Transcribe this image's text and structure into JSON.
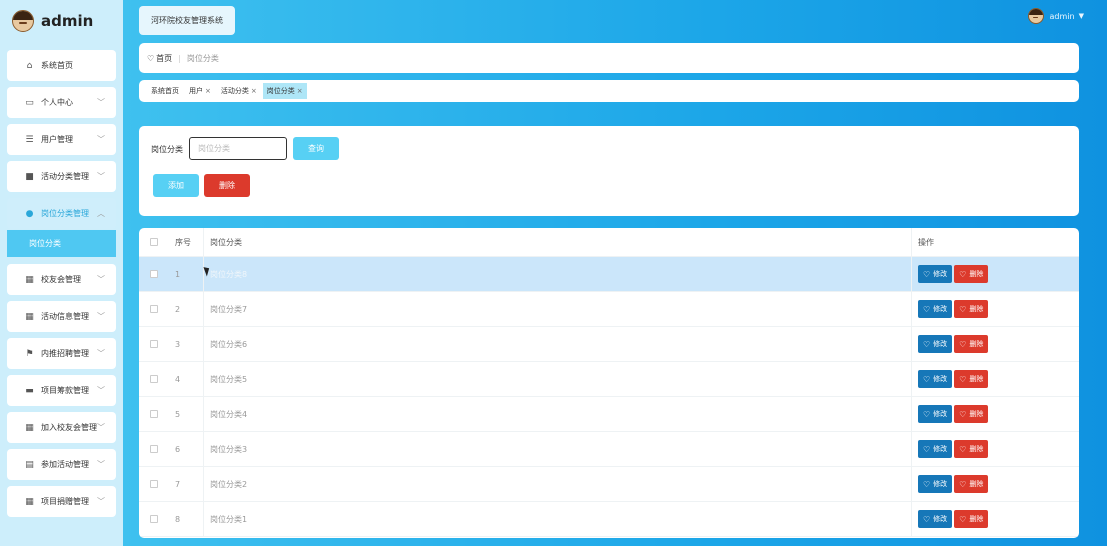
{
  "brand": {
    "name": "admin"
  },
  "sidebar": {
    "items": [
      {
        "label": "系统首页",
        "icon": "home-icon",
        "glyph": "⌂",
        "chevron": false
      },
      {
        "label": "个人中心",
        "icon": "window-icon",
        "glyph": "▭",
        "chevron": true
      },
      {
        "label": "用户管理",
        "icon": "sliders-icon",
        "glyph": "☰",
        "chevron": true
      },
      {
        "label": "活动分类管理",
        "icon": "box-icon",
        "glyph": "■",
        "chevron": true
      },
      {
        "label": "岗位分类管理",
        "icon": "pin-icon",
        "glyph": "●",
        "chevron": true,
        "expanded": true
      },
      {
        "label": "校友会管理",
        "icon": "grid-icon",
        "glyph": "▦",
        "chevron": true
      },
      {
        "label": "活动信息管理",
        "icon": "grid-icon",
        "glyph": "▦",
        "chevron": true
      },
      {
        "label": "内推招聘管理",
        "icon": "flag-icon",
        "glyph": "⚑",
        "chevron": true
      },
      {
        "label": "项目筹款管理",
        "icon": "briefcase-icon",
        "glyph": "▬",
        "chevron": true
      },
      {
        "label": "加入校友会管理",
        "icon": "grid-icon",
        "glyph": "▦",
        "chevron": true
      },
      {
        "label": "参加活动管理",
        "icon": "clipboard-icon",
        "glyph": "▤",
        "chevron": true
      },
      {
        "label": "项目捐赠管理",
        "icon": "grid-icon",
        "glyph": "▦",
        "chevron": true
      }
    ],
    "submenu": {
      "label": "岗位分类"
    }
  },
  "header": {
    "system_title": "河环院校友管理系统",
    "username": "admin"
  },
  "breadcrumb": {
    "home": "首页",
    "current": "岗位分类"
  },
  "tabs": [
    {
      "label": "系统首页",
      "closable": false,
      "active": false
    },
    {
      "label": "用户",
      "closable": true,
      "active": false
    },
    {
      "label": "活动分类",
      "closable": true,
      "active": false
    },
    {
      "label": "岗位分类",
      "closable": true,
      "active": true
    }
  ],
  "search": {
    "label": "岗位分类",
    "placeholder": "岗位分类",
    "button": "查询"
  },
  "actions": {
    "add": "添加",
    "delete": "删除"
  },
  "table": {
    "headers": {
      "index": "序号",
      "name": "岗位分类",
      "ops": "操作"
    },
    "rows": [
      {
        "index": "1",
        "name": "岗位分类8"
      },
      {
        "index": "2",
        "name": "岗位分类7"
      },
      {
        "index": "3",
        "name": "岗位分类6"
      },
      {
        "index": "4",
        "name": "岗位分类5"
      },
      {
        "index": "5",
        "name": "岗位分类4"
      },
      {
        "index": "6",
        "name": "岗位分类3"
      },
      {
        "index": "7",
        "name": "岗位分类2"
      },
      {
        "index": "8",
        "name": "岗位分类1"
      }
    ],
    "edit_label": "修改",
    "delete_label": "删除"
  },
  "colors": {
    "accent": "#57d0f4",
    "danger": "#dc3a2c",
    "edit": "#1677b8",
    "background": "#1ea8ea"
  }
}
